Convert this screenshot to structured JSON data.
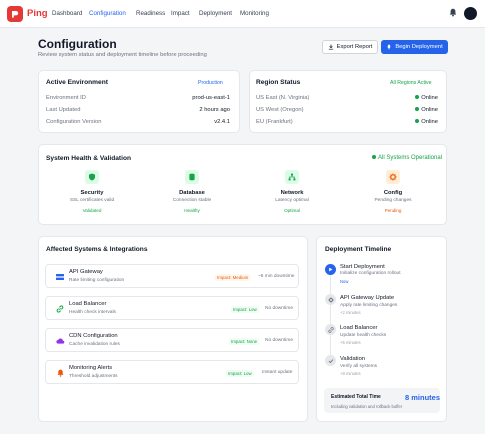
{
  "app": {
    "brand": "Ping",
    "nav": [
      "Dashboard",
      "Configuration",
      "Readiness",
      "Impact",
      "Deployment",
      "Monitoring"
    ],
    "active_nav": "Configuration"
  },
  "header": {
    "title": "Configuration",
    "subtitle": "Review system status and deployment timeline before proceeding",
    "export_label": "Export Report",
    "begin_label": "Begin Deployment"
  },
  "environment": {
    "title": "Active Environment",
    "badge": "Production",
    "rows": [
      {
        "key": "Environment ID",
        "value": "prod-us-east-1"
      },
      {
        "key": "Last Updated",
        "value": "2 hours ago"
      },
      {
        "key": "Configuration Version",
        "value": "v2.4.1"
      }
    ]
  },
  "regions": {
    "title": "Region Status",
    "badge": "All Regions Active",
    "rows": [
      {
        "name": "US East (N. Virginia)",
        "status": "Online"
      },
      {
        "name": "US West (Oregon)",
        "status": "Online"
      },
      {
        "name": "EU (Frankfurt)",
        "status": "Online"
      }
    ]
  },
  "health": {
    "title": "System Health & Validation",
    "badge": "All Systems Operational",
    "items": [
      {
        "name": "Security",
        "desc": "SSL certificates valid",
        "status": "Validated",
        "icon": "shield-icon",
        "color": "#16a34a",
        "bg": "#dcfce7"
      },
      {
        "name": "Database",
        "desc": "Connection stable",
        "status": "Healthy",
        "icon": "database-icon",
        "color": "#16a34a",
        "bg": "#dcfce7"
      },
      {
        "name": "Network",
        "desc": "Latency optimal",
        "status": "Optimal",
        "icon": "network-icon",
        "color": "#16a34a",
        "bg": "#dcfce7"
      },
      {
        "name": "Config",
        "desc": "Pending changes",
        "status": "Pending",
        "icon": "gear-icon",
        "color": "#ea580c",
        "bg": "#ffedd5"
      }
    ]
  },
  "systems": {
    "title": "Affected Systems & Integrations",
    "items": [
      {
        "name": "API Gateway",
        "desc": "Rate limiting configuration",
        "impact": "Impact: Medium",
        "time": "~5 min downtime",
        "icon": "api-icon",
        "color": "#2563eb",
        "impact_color": "#ea580c",
        "impact_bg": "#fff7ed"
      },
      {
        "name": "Load Balancer",
        "desc": "Health check intervals",
        "impact": "Impact: Low",
        "time": "No downtime",
        "icon": "link-icon",
        "color": "#16a34a",
        "impact_color": "#16a34a",
        "impact_bg": "#f0fdf4"
      },
      {
        "name": "CDN Configuration",
        "desc": "Cache invalidation rules",
        "impact": "Impact: None",
        "time": "No downtime",
        "icon": "cloud-icon",
        "color": "#9333ea",
        "impact_color": "#16a34a",
        "impact_bg": "#f0fdf4"
      },
      {
        "name": "Monitoring Alerts",
        "desc": "Threshold adjustments",
        "impact": "Impact: Low",
        "time": "Instant update",
        "icon": "bell-icon",
        "color": "#ea580c",
        "impact_color": "#16a34a",
        "impact_bg": "#f0fdf4"
      }
    ]
  },
  "timeline": {
    "title": "Deployment Timeline",
    "steps": [
      {
        "title": "Start Deployment",
        "desc": "Initialize configuration rollout",
        "time": "Now",
        "icon": "play-icon"
      },
      {
        "title": "API Gateway Update",
        "desc": "Apply rate limiting changes",
        "time": "+2 minutes",
        "icon": "gear-icon"
      },
      {
        "title": "Load Balancer",
        "desc": "Update health checks",
        "time": "+5 minutes",
        "icon": "link-icon"
      },
      {
        "title": "Validation",
        "desc": "Verify all systems",
        "time": "+8 minutes",
        "icon": "check-icon"
      }
    ],
    "estimate_label": "Estimated Total Time",
    "estimate_value": "8 minutes",
    "estimate_note": "Including validation and rollback buffer"
  },
  "colors": {
    "accent": "#2563eb",
    "brand": "#e53935",
    "success": "#16a34a",
    "warning": "#ea580c"
  }
}
